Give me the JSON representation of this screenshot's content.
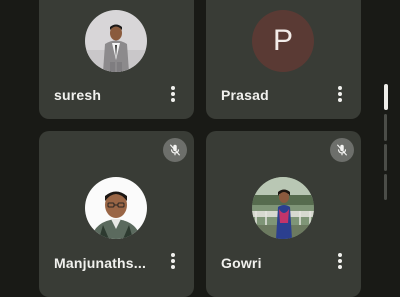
{
  "participants": [
    {
      "name": "suresh",
      "avatar_type": "photo",
      "muted": false
    },
    {
      "name": "Prasad",
      "avatar_type": "letter",
      "initial": "P",
      "avatar_color": "#5a3a34",
      "muted": false
    },
    {
      "name": "Manjunaths...",
      "avatar_type": "photo",
      "muted": true
    },
    {
      "name": "Gowri",
      "avatar_type": "photo",
      "muted": true
    }
  ],
  "icons": {
    "more": "more-vertical-icon",
    "mute": "mic-off-icon"
  },
  "colors": {
    "background": "#191a16",
    "tile": "#393c36",
    "mute_badge": "#6d6f6b",
    "text": "#f1f1ee"
  }
}
